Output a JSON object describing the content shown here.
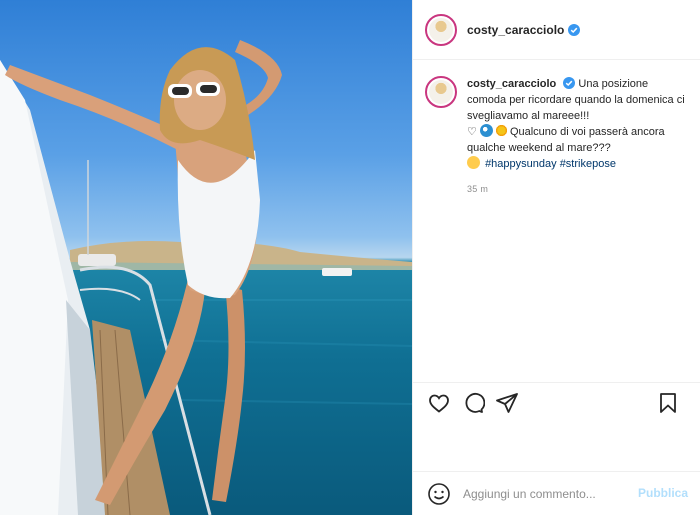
{
  "post": {
    "username": "costy_caracciolo",
    "verified": true,
    "caption": {
      "line1": "Una posizione comoda per ricordare quando la domenica ci svegliavamo al mareee!!!",
      "line2": "Qualcuno di voi passerà ancora qualche weekend al mare???",
      "hashtags": [
        "#happysunday",
        "#strikepose"
      ]
    },
    "timestamp": "35 m",
    "icons": [
      "heart-icon",
      "comment-icon",
      "share-icon",
      "bookmark-icon",
      "smile-icon",
      "verified-badge-icon"
    ],
    "colors": {
      "verified_blue": "#3897f0",
      "link": "#00376b",
      "publish_disabled": "#b2dffc",
      "story_ring": "#c9367f"
    }
  },
  "comment": {
    "placeholder": "Aggiungi un commento...",
    "publish_label": "Pubblica"
  }
}
